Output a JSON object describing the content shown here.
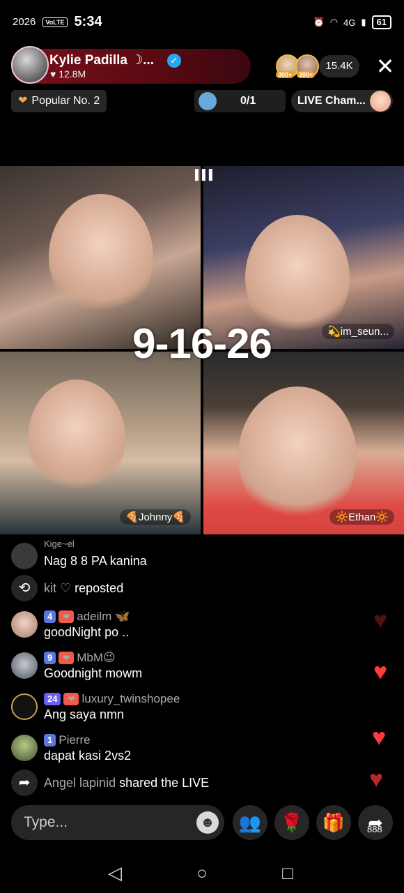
{
  "status_bar": {
    "left_text": "2026",
    "volte": "VoLTE",
    "time": "5:34",
    "signal": "4G",
    "battery": "61"
  },
  "host": {
    "name": "Kylie Padilla ☽...",
    "likes": "♥ 12.8M",
    "verified_icon": "verified-icon"
  },
  "viewers": {
    "badge_a": "300+",
    "badge_b": "300+",
    "count": "15.4K"
  },
  "header": {
    "popular_label": "Popular No. 2",
    "ranking_count": "0/1",
    "champ_label": "LIVE Cham..."
  },
  "grid": {
    "tiles": [
      {
        "name": ""
      },
      {
        "name": "💫im_seun..."
      },
      {
        "name": "🍕Johnny🍕"
      },
      {
        "name": "🔆Ethan🔆"
      }
    ],
    "overlay": "9-16-26"
  },
  "chat": {
    "partial_user": "Kige~el",
    "messages": [
      {
        "kind": "message",
        "text": "Nag 8 8 PA kanina"
      },
      {
        "kind": "system",
        "user": "kit ♡",
        "text": "reposted"
      },
      {
        "kind": "message",
        "level": "4",
        "user": "adeilm 🦋",
        "text": "goodNight po .."
      },
      {
        "kind": "message",
        "level": "9",
        "user": "MbM😉",
        "text": "Goodnight mowm"
      },
      {
        "kind": "message",
        "level": "24",
        "user": "luxury_twinshopee",
        "text": "Ang saya nmn"
      },
      {
        "kind": "message",
        "level": "1",
        "user": "Pierre",
        "text": "dapat kasi 2vs2"
      },
      {
        "kind": "system",
        "user": "Angel lapinid",
        "text": "shared the LIVE"
      }
    ]
  },
  "bottom_bar": {
    "placeholder": "Type...",
    "share_count": "888"
  },
  "colors": {
    "host_pill": "#7a0f1a",
    "level_badge": "#5a78d9",
    "heart": "#ff3b3b"
  }
}
